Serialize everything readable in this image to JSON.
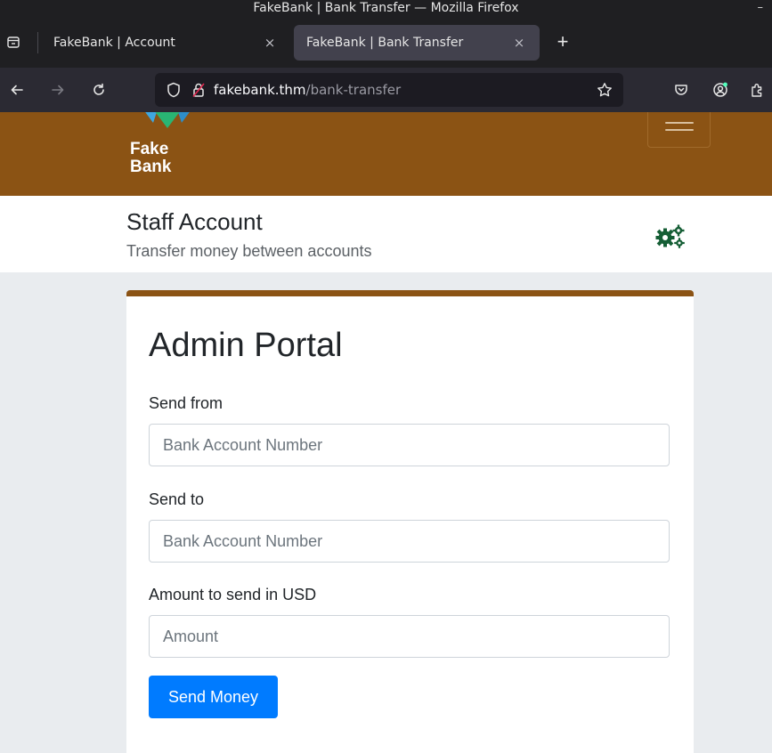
{
  "window": {
    "title": "FakeBank | Bank Transfer — Mozilla Firefox",
    "controls": "–"
  },
  "tabs": [
    {
      "title": "FakeBank | Account",
      "active": false
    },
    {
      "title": "FakeBank | Bank Transfer",
      "active": true
    }
  ],
  "tab_close_glyph": "×",
  "new_tab_glyph": "+",
  "urlbar": {
    "domain": "fakebank.thm",
    "path": "/bank-transfer"
  },
  "site": {
    "logo_line1": "Fake",
    "logo_line2": "Bank",
    "brand_color": "#8b5314"
  },
  "page": {
    "title": "Staff Account",
    "subtitle": "Transfer money between accounts"
  },
  "form": {
    "heading": "Admin Portal",
    "send_from_label": "Send from",
    "send_from_placeholder": "Bank Account Number",
    "send_to_label": "Send to",
    "send_to_placeholder": "Bank Account Number",
    "amount_label": "Amount to send in USD",
    "amount_placeholder": "Amount",
    "submit_label": "Send Money"
  },
  "icons": {
    "tab_list": "tab-list-icon",
    "back": "back-arrow-icon",
    "forward": "forward-arrow-icon",
    "reload": "reload-icon",
    "shield": "tracking-shield-icon",
    "insecure": "insecure-lock-icon",
    "bookmark": "star-icon",
    "pocket": "pocket-icon",
    "account": "account-icon",
    "extensions": "extensions-icon",
    "settings": "gears-icon"
  }
}
